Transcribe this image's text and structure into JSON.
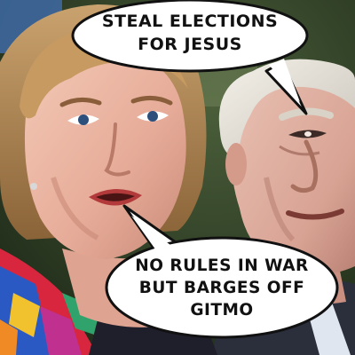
{
  "colors": {
    "background": "#2a3a22",
    "bubble_fill": "#ffffff",
    "bubble_outline": "#111111",
    "text": "#111111"
  },
  "speech_bubbles": {
    "top": {
      "lines": [
        "STEAL ELECTIONS",
        "FOR JESUS"
      ]
    },
    "bottom": {
      "lines": [
        "NO RULES IN WAR",
        "BUT BARGES OFF",
        "GITMO"
      ]
    }
  },
  "figures": [
    {
      "name": "woman-portrait"
    },
    {
      "name": "man-portrait"
    }
  ]
}
